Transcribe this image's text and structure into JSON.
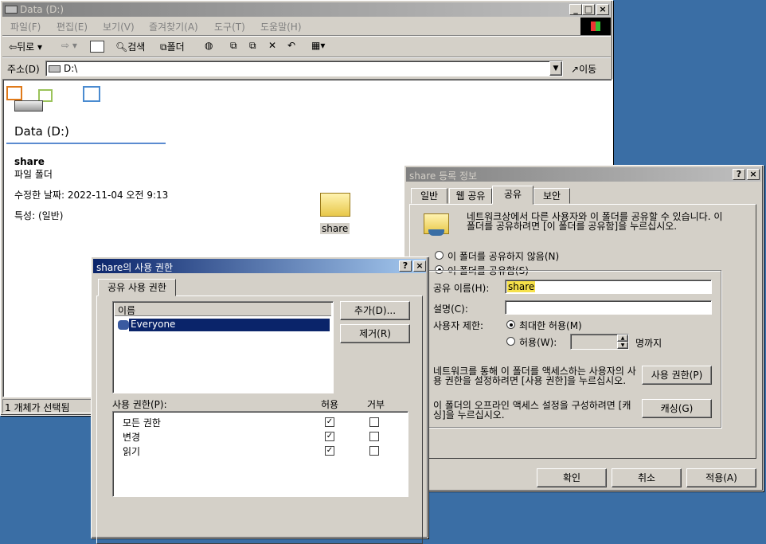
{
  "explorer": {
    "title": "Data (D:)",
    "menu": [
      "파일(F)",
      "편집(E)",
      "보기(V)",
      "즐겨찾기(A)",
      "도구(T)",
      "도움말(H)"
    ],
    "toolbar": {
      "back": "뒤로",
      "search": "검색",
      "folders": "폴더"
    },
    "address_label": "주소(D)",
    "address_value": "D:\\",
    "go_label": "이동",
    "drive_title": "Data (D:)",
    "selected_name": "share",
    "selected_type": "파일 폴더",
    "modified": "수정한 날짜: 2022-11-04 오전 9:13",
    "attributes": "특성: (일반)",
    "folder_label": "share",
    "status": "1 개체가 선택됨"
  },
  "props": {
    "title": "share 등록 정보",
    "tabs": [
      "일반",
      "웹 공유",
      "공유",
      "보안"
    ],
    "info": "네트워크상에서 다른 사용자와 이 폴더를 공유할 수 있습니다. 이 폴더를 공유하려면 [이 폴더를 공유함]을 누르십시오.",
    "no_share": "이 폴더를 공유하지 않음(N)",
    "share": "이 폴더를 공유함(S)",
    "share_name_label": "공유 이름(H):",
    "share_name_value": "share",
    "desc_label": "설명(C):",
    "user_limit_label": "사용자 제한:",
    "max_allowed": "최대한 허용(M)",
    "allow": "허용(W):",
    "users_suffix": "명까지",
    "perm_text": "네트워크를 통해 이 폴더를 액세스하는 사용자의 사용 권한을 설정하려면 [사용 권한]을 누르십시오.",
    "perm_button": "사용 권한(P)",
    "cache_text": "이 폴더의 오프라인 액세스 설정을 구성하려면 [캐싱]을 누르십시오.",
    "cache_button": "캐싱(G)",
    "ok": "확인",
    "cancel": "취소",
    "apply": "적용(A)"
  },
  "perm": {
    "title": "share의 사용 권한",
    "tab": "공유 사용 권한",
    "name_header": "이름",
    "entries": [
      "Everyone"
    ],
    "add": "추가(D)...",
    "remove": "제거(R)",
    "perm_label": "사용 권한(P):",
    "allow_header": "허용",
    "deny_header": "거부",
    "rows": [
      {
        "name": "모든 권한",
        "allow": true,
        "deny": false
      },
      {
        "name": "변경",
        "allow": true,
        "deny": false
      },
      {
        "name": "읽기",
        "allow": true,
        "deny": false
      }
    ]
  }
}
